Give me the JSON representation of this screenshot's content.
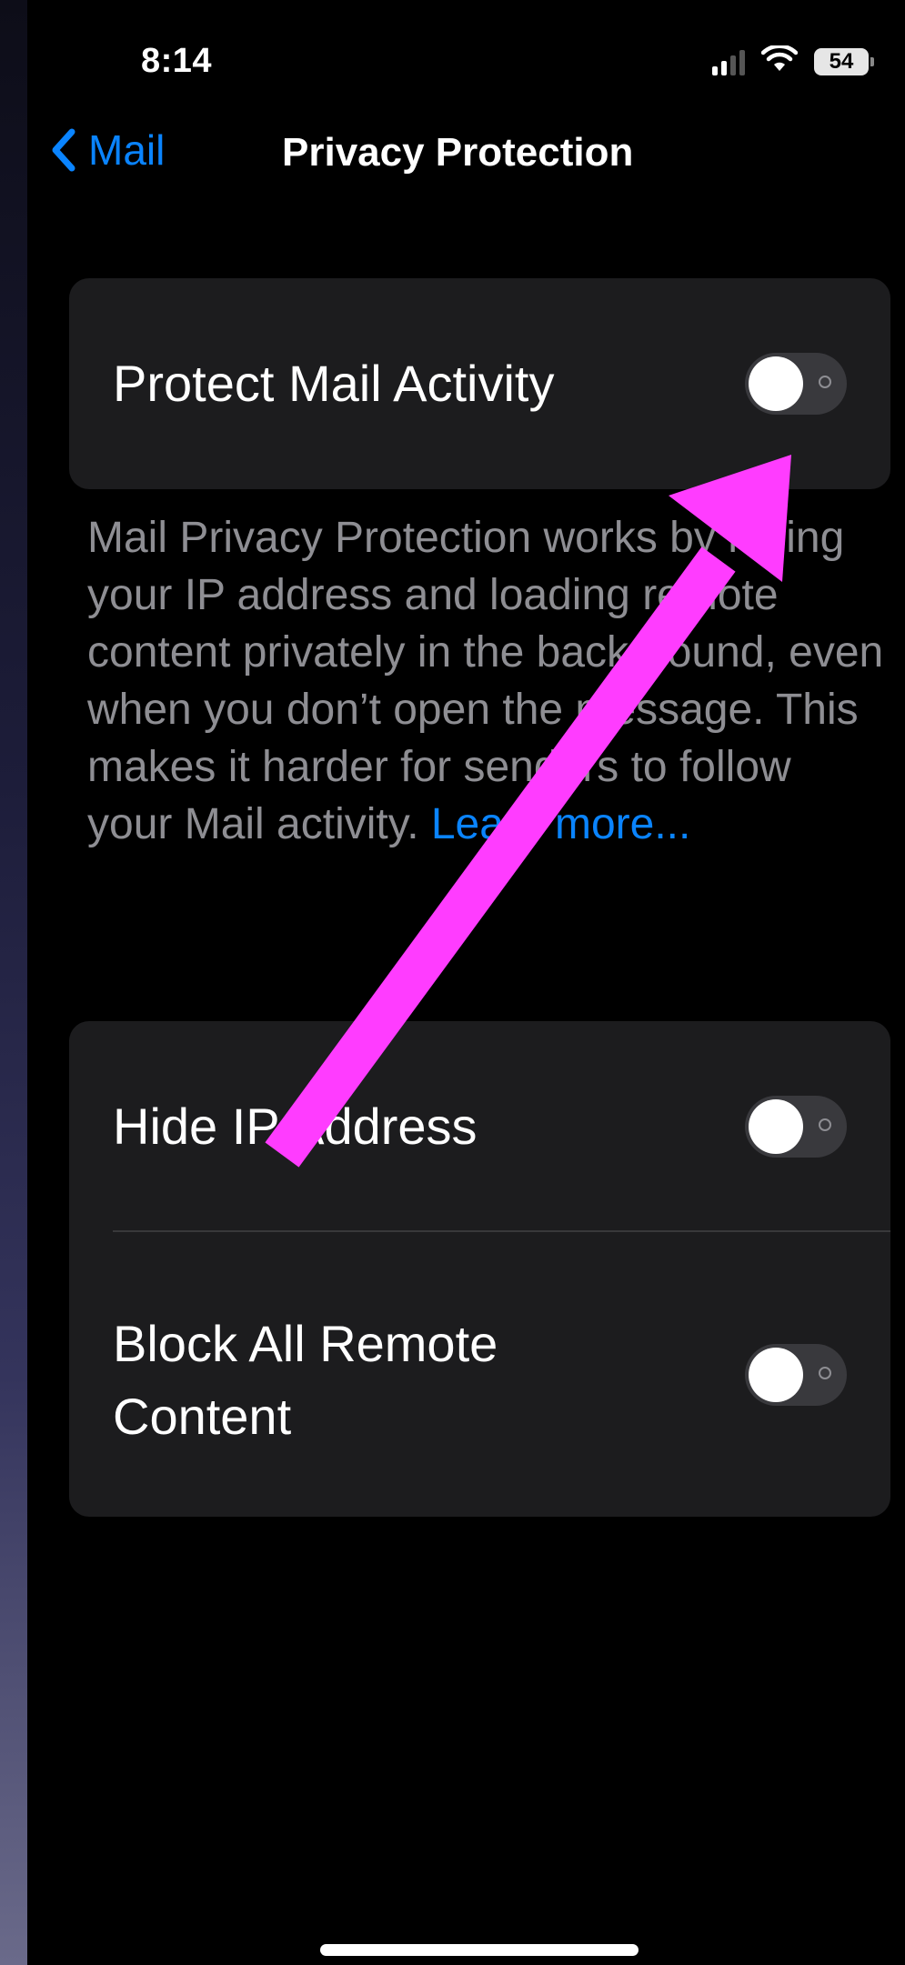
{
  "status_bar": {
    "time": "8:14",
    "battery": "54"
  },
  "nav": {
    "back_label": "Mail",
    "title": "Privacy Protection"
  },
  "protect_mail_activity": {
    "label": "Protect Mail Activity",
    "enabled": false
  },
  "description": {
    "text": "Mail Privacy Protection works by hiding your IP address and loading remote content privately in the background, even when you don’t open the message. This makes it harder for senders to follow your Mail activity. ",
    "link": "Learn more..."
  },
  "options": [
    {
      "label": "Hide IP Address",
      "enabled": false
    },
    {
      "label": "Block All Remote Content",
      "enabled": false
    }
  ],
  "colors": {
    "background": "#000000",
    "card": "#1c1c1e",
    "accent_blue": "#0a84ff",
    "secondary_text": "#8e8e93",
    "toggle_off": "#39393d",
    "annotation_arrow": "#ff3cff"
  }
}
